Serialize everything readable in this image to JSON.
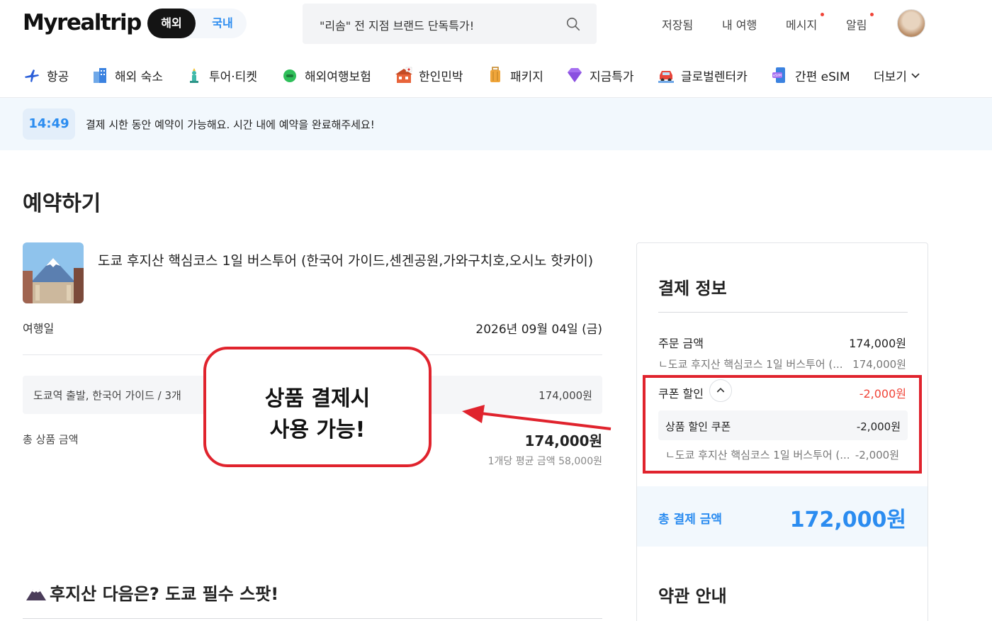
{
  "header": {
    "logo": "Myrealtrip",
    "region": [
      "해외",
      "국내"
    ],
    "search_placeholder": "\"리솜\" 전 지점 브랜드 단독특가!",
    "links": [
      "저장됨",
      "내 여행",
      "메시지",
      "알림"
    ]
  },
  "categories": [
    {
      "label": "항공",
      "icon": "airplane-icon"
    },
    {
      "label": "해외 숙소",
      "icon": "hotel-building-icon"
    },
    {
      "label": "투어·티켓",
      "icon": "statue-of-liberty-icon"
    },
    {
      "label": "해외여행보험",
      "icon": "insurance-icon"
    },
    {
      "label": "한인민박",
      "icon": "korean-house-icon"
    },
    {
      "label": "패키지",
      "icon": "luggage-icon"
    },
    {
      "label": "지금특가",
      "icon": "diamond-icon"
    },
    {
      "label": "글로벌렌터카",
      "icon": "car-icon"
    },
    {
      "label": "간편 eSIM",
      "icon": "esim-phone-icon"
    },
    {
      "label": "더보기",
      "icon": "chevron-down-icon"
    }
  ],
  "timer": {
    "time": "14:49",
    "message": "결제 시한 동안 예약이 가능해요. 시간 내에 예약을 완료해주세요!"
  },
  "page_title": "예약하기",
  "product": {
    "title": "도쿄 후지산 핵심코스 1일 버스투어 (한국어 가이드,센겐공원,가와구치호,오시노 핫카이)",
    "date_label": "여행일",
    "date_value": "2026년 09월 04일 (금)",
    "option_label": "도쿄역 출발, 한국어 가이드 / 3개",
    "option_price": "174,000원",
    "total_label": "총 상품 금액",
    "total_price": "174,000원",
    "avg_price": "1개당 평균 금액 58,000원"
  },
  "callout": {
    "line1": "상품 결제시",
    "line2": "사용 가능!"
  },
  "next_section_title": "후지산 다음은? 도쿄 필수 스팟!",
  "payment": {
    "title": "결제 정보",
    "order_label": "주문 금액",
    "order_value": "174,000원",
    "order_sub_label": "ㄴ도쿄 후지산 핵심코스 1일 버스투어 (...",
    "order_sub_value": "174,000원",
    "coupon_label": "쿠폰 할인",
    "coupon_value": "-2,000원",
    "coupon_item_label": "상품 할인 쿠폰",
    "coupon_item_value": "-2,000원",
    "coupon_sub_label": "ㄴ도쿄 후지산 핵심코스 1일 버스투어 (...",
    "coupon_sub_value": "-2,000원",
    "grand_label": "총 결제 금액",
    "grand_value": "172,000원",
    "terms_title": "약관 안내"
  },
  "colors": {
    "accent": "#2b8cf0",
    "discount": "#f04438",
    "annotation": "#e0232d"
  }
}
